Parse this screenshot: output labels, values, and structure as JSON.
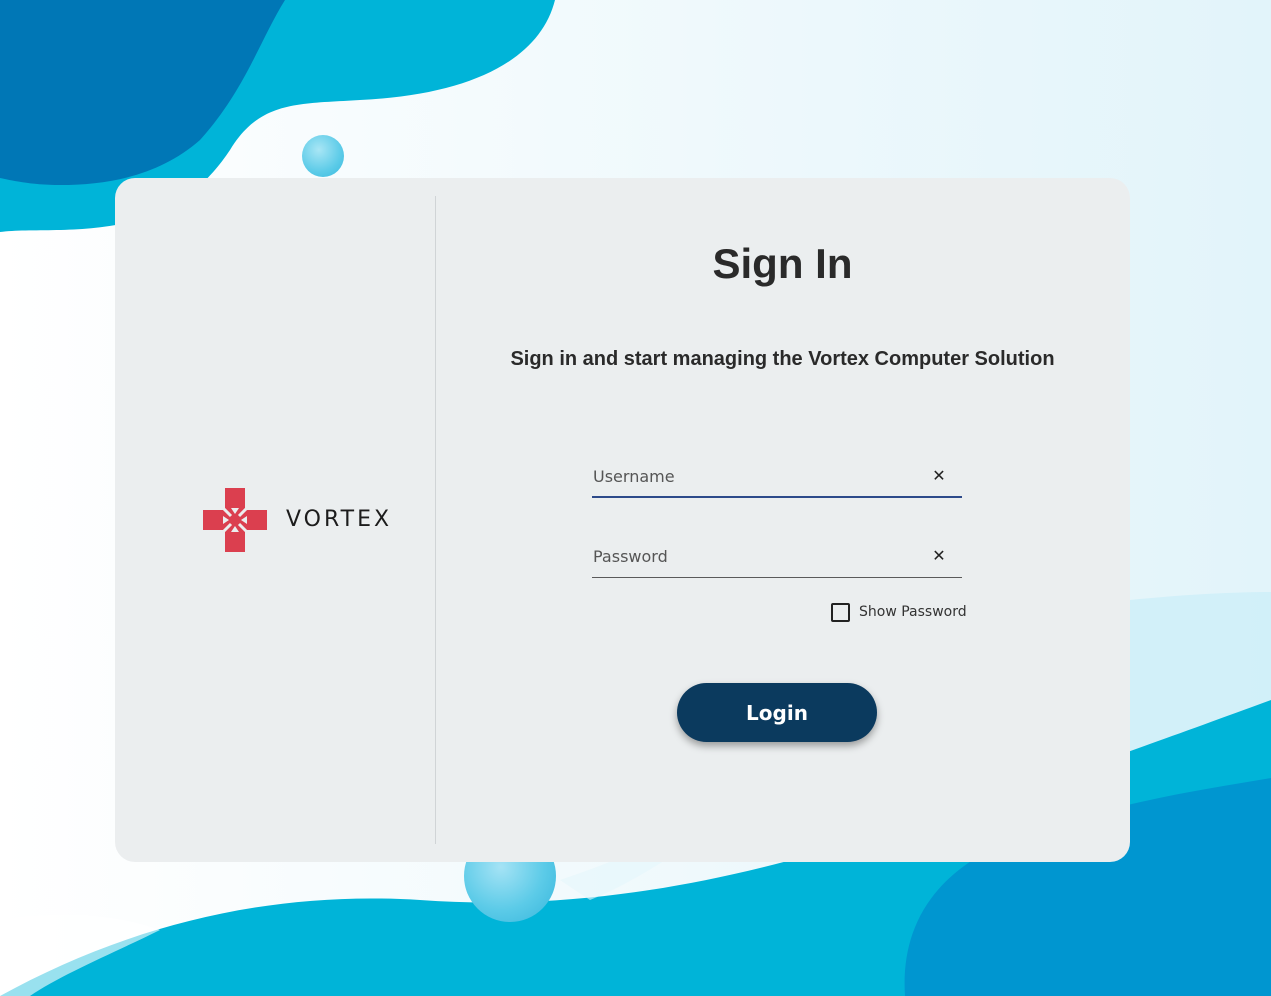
{
  "brand": {
    "name": "VORTEX",
    "logo_color": "#db3f4f"
  },
  "form": {
    "title": "Sign In",
    "subtitle": "Sign in and start managing the Vortex Computer Solution",
    "username": {
      "placeholder": "Username",
      "value": ""
    },
    "password": {
      "placeholder": "Password",
      "value": ""
    },
    "show_password_label": "Show Password",
    "show_password_checked": false,
    "login_label": "Login",
    "clear_icon": "close-icon",
    "clear_glyph": "✕"
  },
  "colors": {
    "card_background": "#ebeeef",
    "button": "#0b3a5e",
    "accent_light": "#00b4d8",
    "accent_dark": "#0077b6",
    "active_underline": "#2d4a8a"
  }
}
